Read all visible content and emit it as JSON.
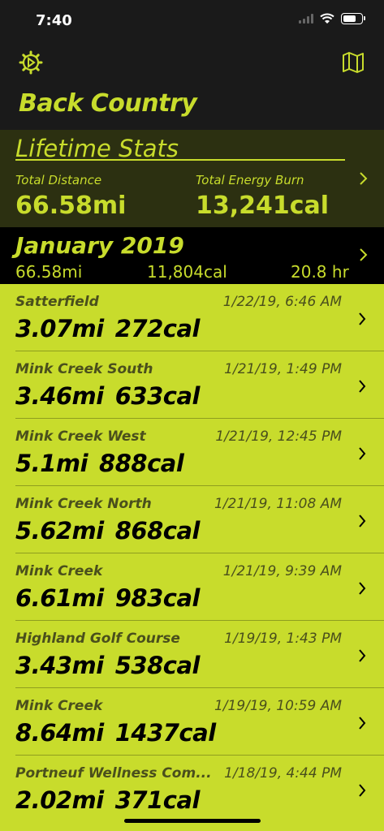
{
  "status_bar": {
    "time": "7:40"
  },
  "header": {
    "title": "Back Country",
    "settings_icon": "gear-icon",
    "map_icon": "map-icon"
  },
  "lifetime": {
    "title": "Lifetime Stats",
    "distance_label": "Total Distance",
    "distance_value": "66.58mi",
    "energy_label": "Total Energy Burn",
    "energy_value": "13,241cal"
  },
  "month": {
    "title": "January 2019",
    "distance": "66.58mi",
    "calories": "11,804cal",
    "duration": "20.8 hr"
  },
  "activities": [
    {
      "name": "Satterfield",
      "date": "1/22/19, 6:46 AM",
      "distance": "3.07mi",
      "calories": "272cal"
    },
    {
      "name": "Mink Creek South",
      "date": "1/21/19, 1:49 PM",
      "distance": "3.46mi",
      "calories": "633cal"
    },
    {
      "name": "Mink Creek West",
      "date": "1/21/19, 12:45 PM",
      "distance": "5.1mi",
      "calories": "888cal"
    },
    {
      "name": "Mink Creek North",
      "date": "1/21/19, 11:08 AM",
      "distance": "5.62mi",
      "calories": "868cal"
    },
    {
      "name": "Mink Creek",
      "date": "1/21/19, 9:39 AM",
      "distance": "6.61mi",
      "calories": "983cal"
    },
    {
      "name": "Highland Golf Course",
      "date": "1/19/19, 1:43 PM",
      "distance": "3.43mi",
      "calories": "538cal"
    },
    {
      "name": "Mink Creek",
      "date": "1/19/19, 10:59 AM",
      "distance": "8.64mi",
      "calories": "1437cal"
    },
    {
      "name": "Portneuf Wellness Com...",
      "date": "1/18/19, 4:44 PM",
      "distance": "2.02mi",
      "calories": "371cal"
    }
  ],
  "colors": {
    "accent": "#c8dc2c",
    "header_bg": "#1a1a1a",
    "stats_bg": "#2c3011",
    "month_bg": "#000000"
  }
}
